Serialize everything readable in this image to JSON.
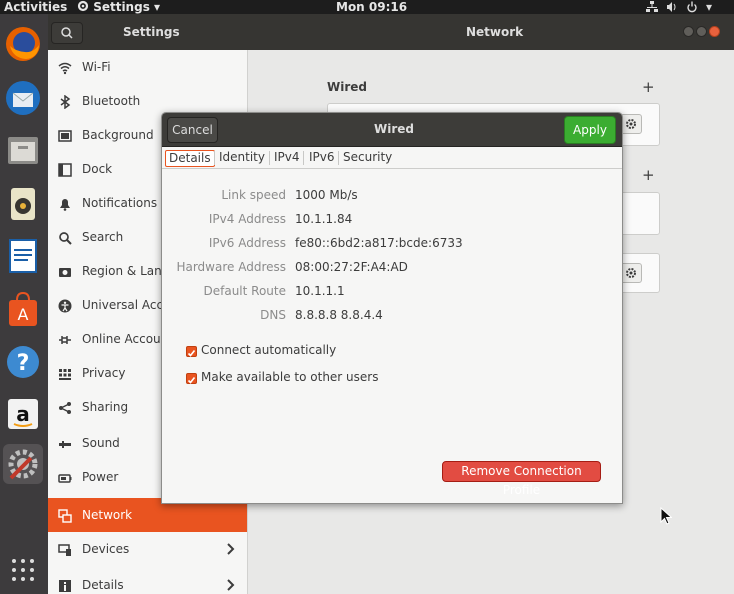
{
  "topbar": {
    "activities": "Activities",
    "app_menu": "Settings",
    "clock": "Mon 09:16"
  },
  "dock": {
    "items": [
      "firefox-icon",
      "thunderbird-icon",
      "files-icon",
      "rhythmbox-icon",
      "libreoffice-writer-icon",
      "ubuntu-software-icon",
      "help-icon",
      "amazon-icon",
      "settings-icon",
      "show-apps-icon"
    ]
  },
  "header": {
    "left_title": "Settings",
    "right_title": "Network"
  },
  "sidebar": {
    "items": [
      {
        "label": "Wi-Fi",
        "icon": "wifi-icon"
      },
      {
        "label": "Bluetooth",
        "icon": "bluetooth-icon"
      },
      {
        "label": "Background",
        "icon": "background-icon"
      },
      {
        "label": "Dock",
        "icon": "dock-icon"
      },
      {
        "label": "Notifications",
        "icon": "bell-icon"
      },
      {
        "label": "Search",
        "icon": "search-icon"
      },
      {
        "label": "Region & Langu",
        "icon": "camera-icon"
      },
      {
        "label": "Universal Acce",
        "icon": "accessibility-icon"
      },
      {
        "label": "Online Accoun",
        "icon": "online-accounts-icon"
      },
      {
        "label": "Privacy",
        "icon": "privacy-icon"
      },
      {
        "label": "Sharing",
        "icon": "share-icon"
      },
      {
        "label": "Sound",
        "icon": "sound-icon"
      },
      {
        "label": "Power",
        "icon": "power-icon"
      },
      {
        "label": "Network",
        "icon": "network-icon",
        "selected": true
      },
      {
        "label": "Devices",
        "icon": "devices-icon"
      },
      {
        "label": "Details",
        "icon": "details-icon"
      }
    ]
  },
  "main": {
    "wired_heading": "Wired"
  },
  "dialog": {
    "cancel_label": "Cancel",
    "title": "Wired",
    "apply_label": "Apply",
    "tabs": [
      "Details",
      "Identity",
      "IPv4",
      "IPv6",
      "Security"
    ],
    "active_tab": "Details",
    "details": [
      {
        "label": "Link speed",
        "value": "1000 Mb/s"
      },
      {
        "label": "IPv4 Address",
        "value": "10.1.1.84"
      },
      {
        "label": "IPv6 Address",
        "value": "fe80::6bd2:a817:bcde:6733"
      },
      {
        "label": "Hardware Address",
        "value": "08:00:27:2F:A4:AD"
      },
      {
        "label": "Default Route",
        "value": "10.1.1.1"
      },
      {
        "label": "DNS",
        "value": "8.8.8.8 8.8.4.4"
      }
    ],
    "connect_automatically": {
      "label": "Connect automatically",
      "checked": true
    },
    "make_available": {
      "label": "Make available to other users",
      "checked": true
    },
    "remove_label": "Remove Connection Profile"
  },
  "colors": {
    "accent": "#e95420",
    "apply": "#3bad31",
    "remove": "#e24c42",
    "header": "#363532"
  }
}
